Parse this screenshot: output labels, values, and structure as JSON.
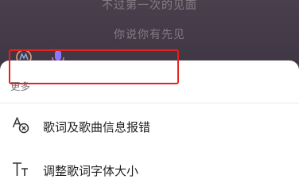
{
  "background": {
    "lyric_line_1": "不过第一次的见面",
    "lyric_line_2": "你说你有先见",
    "left_icon": "app-badge-icon",
    "mic_icon": "microphone-icon"
  },
  "sheet": {
    "title": "更多",
    "items": [
      {
        "label": "歌词及歌曲信息报错",
        "icon": "lyric-error-report-icon",
        "highlighted": true
      },
      {
        "label": "调整歌词字体大小",
        "icon": "font-size-icon",
        "highlighted": false
      }
    ]
  },
  "colors": {
    "highlight": "#e8201c",
    "sheet_background": "#ffffff",
    "backdrop": "#3e3644"
  }
}
